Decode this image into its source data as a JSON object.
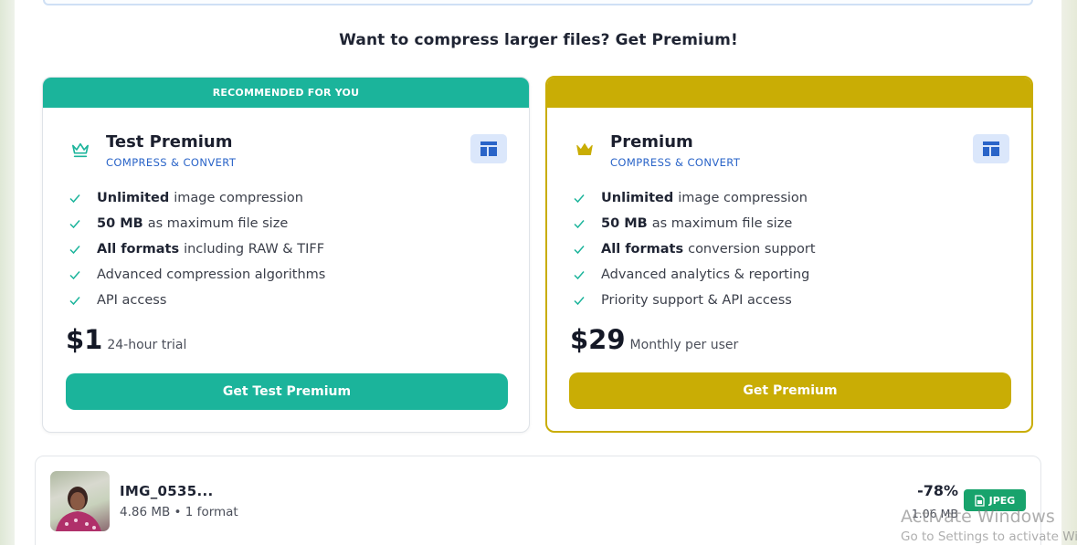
{
  "headline": {
    "prefix": "Want to compress larger files? Get ",
    "emphasis": "Premium!"
  },
  "plans": [
    {
      "banner": "RECOMMENDED FOR YOU",
      "name": "Test Premium",
      "subtitle": "COMPRESS & CONVERT",
      "icon": "crown-outline-icon",
      "features": [
        {
          "bold": "Unlimited",
          "text": "image compression"
        },
        {
          "bold": "50 MB",
          "text": "as maximum file size"
        },
        {
          "bold": "All formats",
          "text": "including RAW & TIFF"
        },
        {
          "bold": "",
          "text": "Advanced compression algorithms"
        },
        {
          "bold": "",
          "text": "API access"
        }
      ],
      "price": "$1",
      "price_note": "24-hour trial",
      "cta": "Get Test Premium",
      "accent": "#1bb49b"
    },
    {
      "banner": "",
      "name": "Premium",
      "subtitle": "COMPRESS & CONVERT",
      "icon": "crown-filled-icon",
      "features": [
        {
          "bold": "Unlimited",
          "text": "image compression"
        },
        {
          "bold": "50 MB",
          "text": "as maximum file size"
        },
        {
          "bold": "All formats",
          "text": "conversion support"
        },
        {
          "bold": "",
          "text": "Advanced analytics & reporting"
        },
        {
          "bold": "",
          "text": "Priority support & API access"
        }
      ],
      "price": "$29",
      "price_note": "Monthly per user",
      "cta": "Get Premium",
      "accent": "#c9ad05"
    }
  ],
  "file": {
    "name": "IMG_0535...",
    "meta": "4.86 MB • 1 format",
    "reduction": "-78%",
    "output_size": "1.06 MB",
    "format": "JPEG"
  },
  "watermark": {
    "line1": "Activate Windows",
    "line2": "Go to Settings to activate Windows."
  },
  "colors": {
    "teal": "#1bb49b",
    "gold": "#c9ad05",
    "link_blue": "#2a64c8",
    "jpeg_green": "#18a36c"
  }
}
